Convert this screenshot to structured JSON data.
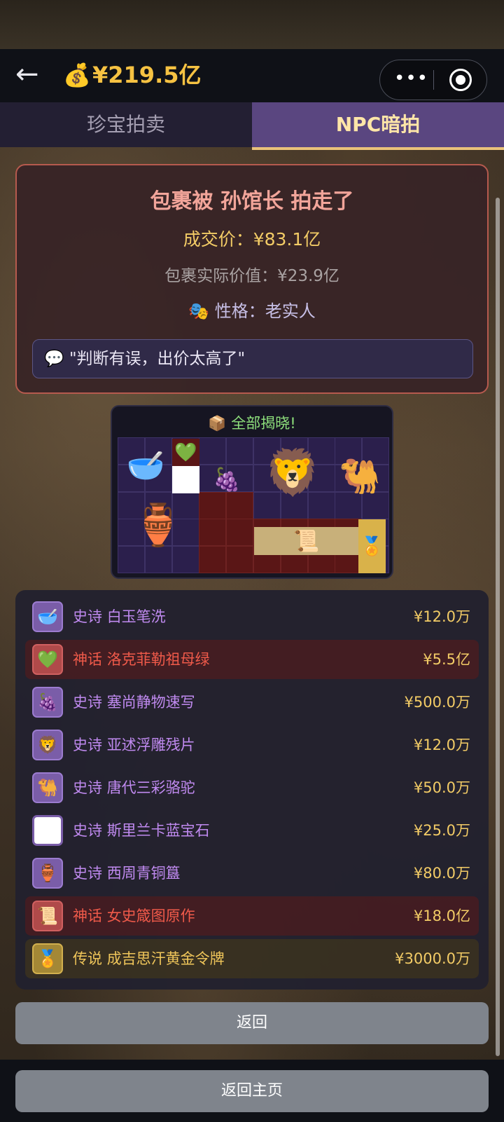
{
  "header": {
    "back_icon": "←",
    "money_icon": "💰",
    "money": "¥219.5亿",
    "more_icon": "•••"
  },
  "tabs": [
    {
      "label": "珍宝拍卖",
      "active": false
    },
    {
      "label": "NPC暗拍",
      "active": true
    }
  ],
  "result": {
    "title": "包裹被 孙馆长 拍走了",
    "price_line": "成交价：¥83.1亿",
    "value_line": "包裹实际价值：¥23.9亿",
    "personality_icon": "🎭",
    "personality_line": "性格：老实人",
    "quote_icon": "💬",
    "quote": "\"判断有误，出价太高了\""
  },
  "reveal": {
    "icon": "📦",
    "title": "全部揭晓!"
  },
  "items": [
    {
      "rarity": "史诗",
      "name": "白玉笔洗",
      "price": "¥12.0万",
      "tier": "epic",
      "icon": "🥣"
    },
    {
      "rarity": "神话",
      "name": "洛克菲勒祖母绿",
      "price": "¥5.5亿",
      "tier": "myth",
      "icon": "💚"
    },
    {
      "rarity": "史诗",
      "name": "塞尚静物速写",
      "price": "¥500.0万",
      "tier": "epic",
      "icon": "🍇"
    },
    {
      "rarity": "史诗",
      "name": "亚述浮雕残片",
      "price": "¥12.0万",
      "tier": "epic",
      "icon": "🦁"
    },
    {
      "rarity": "史诗",
      "name": "唐代三彩骆驼",
      "price": "¥50.0万",
      "tier": "epic",
      "icon": "🐫"
    },
    {
      "rarity": "史诗",
      "name": "斯里兰卡蓝宝石",
      "price": "¥25.0万",
      "tier": "white",
      "icon": ""
    },
    {
      "rarity": "史诗",
      "name": "西周青铜簋",
      "price": "¥80.0万",
      "tier": "epic",
      "icon": "🏺"
    },
    {
      "rarity": "神话",
      "name": "女史箴图原作",
      "price": "¥18.0亿",
      "tier": "myth",
      "icon": "📜"
    },
    {
      "rarity": "传说",
      "name": "成吉思汗黄金令牌",
      "price": "¥3000.0万",
      "tier": "legend",
      "icon": "🏅"
    }
  ],
  "buttons": {
    "back": "返回",
    "home": "返回主页"
  }
}
